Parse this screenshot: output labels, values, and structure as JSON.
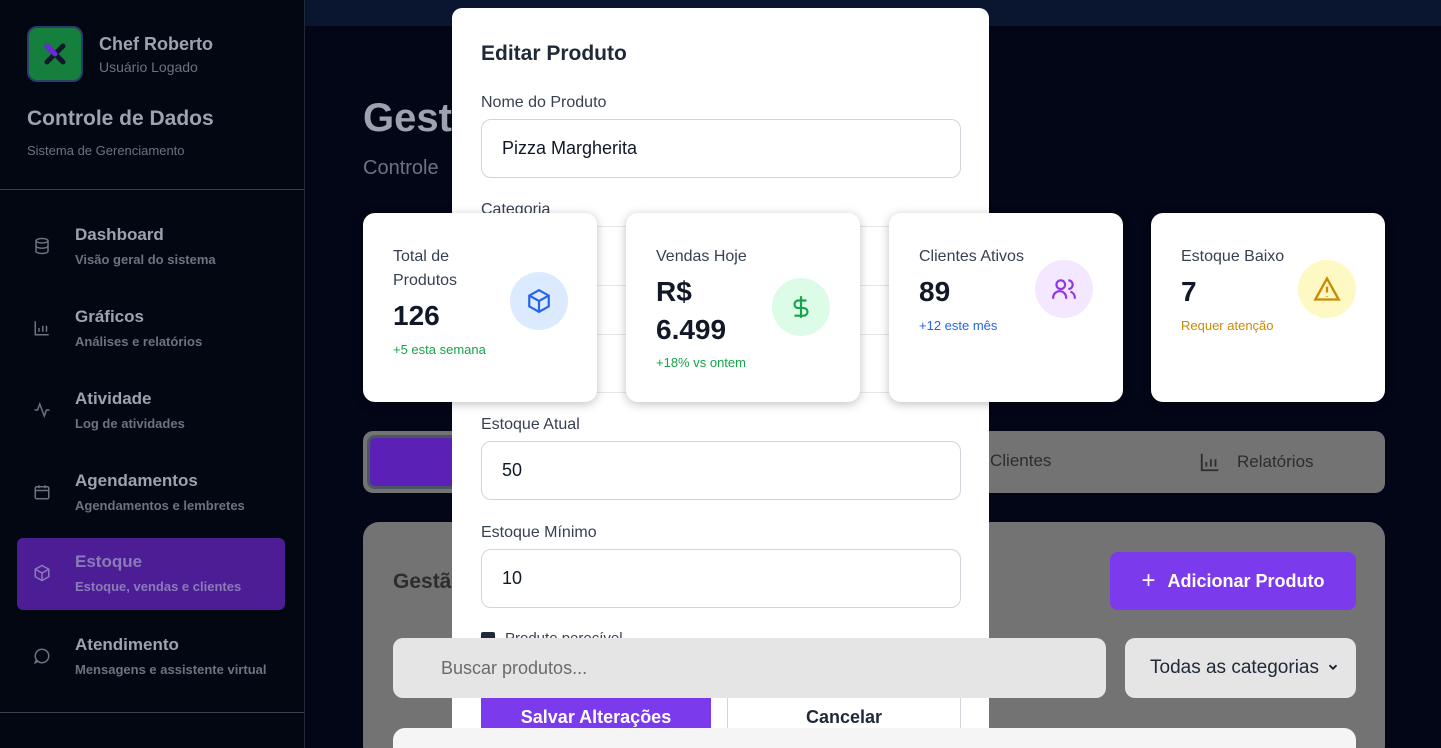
{
  "user": {
    "name": "Chef Roberto",
    "role": "Usuário Logado"
  },
  "brand": {
    "title": "Controle de Dados",
    "subtitle": "Sistema de Gerenciamento"
  },
  "nav": [
    {
      "label": "Dashboard",
      "desc": "Visão geral do sistema",
      "icon": "database-icon"
    },
    {
      "label": "Gráficos",
      "desc": "Análises e relatórios",
      "icon": "bar-chart-icon"
    },
    {
      "label": "Atividade",
      "desc": "Log de atividades",
      "icon": "activity-icon"
    },
    {
      "label": "Agendamentos",
      "desc": "Agendamentos e lembretes",
      "icon": "calendar-icon"
    },
    {
      "label": "Estoque",
      "desc": "Estoque, vendas e clientes",
      "icon": "package-icon",
      "active": true
    },
    {
      "label": "Atendimento",
      "desc": "Mensagens e assistente virtual",
      "icon": "message-circle-icon"
    }
  ],
  "page": {
    "title_partial": "Gest",
    "subtitle_partial": "Controle"
  },
  "modal": {
    "title": "Editar Produto",
    "name_label": "Nome do Produto",
    "name_value": "Pizza Margherita",
    "category_label": "Categoria",
    "stock_label": "Estoque Atual",
    "stock_value": "50",
    "min_stock_label": "Estoque Mínimo",
    "min_stock_value": "10",
    "perishable_label": "Produto perecível",
    "save_label": "Salvar Alterações",
    "cancel_label": "Cancelar"
  },
  "stats": [
    {
      "label": "Total de Produtos",
      "value": "126",
      "note": "+5 esta semana",
      "note_color": "#16a34a",
      "icon": "package-icon",
      "icon_bg": "#dbeafe",
      "icon_color": "#2563eb"
    },
    {
      "label": "Vendas Hoje",
      "value_line1": "R$",
      "value_line2": "6.499",
      "note": "+18% vs ontem",
      "note_color": "#16a34a",
      "icon": "dollar-icon",
      "icon_bg": "#dcfce7",
      "icon_color": "#16a34a"
    },
    {
      "label": "Clientes Ativos",
      "value": "89",
      "note": "+12 este mês",
      "note_color": "#2563eb",
      "icon": "users-icon",
      "icon_bg": "#f3e8ff",
      "icon_color": "#9333ea"
    },
    {
      "label": "Estoque Baixo",
      "value": "7",
      "note": "Requer atenção",
      "note_color": "#ca8a04",
      "icon": "alert-triangle-icon",
      "icon_bg": "#fef9c3",
      "icon_color": "#ca8a04"
    }
  ],
  "tabs": [
    {
      "label": "Clientes",
      "icon": "users-icon"
    },
    {
      "label": "Relatórios",
      "icon": "bar-chart-icon"
    }
  ],
  "panel": {
    "title_partial": "Gestã",
    "add_button": "Adicionar Produto",
    "search_placeholder": "Buscar produtos...",
    "category_filter": "Todas as categorias"
  }
}
